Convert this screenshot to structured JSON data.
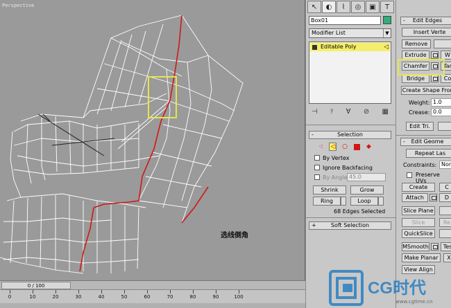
{
  "viewport": {
    "label": "Perspective",
    "caption": "选线倒角"
  },
  "timeline": {
    "frame_display": "0 / 100",
    "ticks": [
      "0",
      "10",
      "20",
      "30",
      "40",
      "50",
      "60",
      "70",
      "80",
      "90",
      "100"
    ]
  },
  "panel": {
    "tabs": [
      "create-icon",
      "modify-icon",
      "hierarchy-icon",
      "motion-icon",
      "display-icon",
      "utilities-icon"
    ],
    "object_name": "Box01",
    "object_color": "#2fae7d",
    "modifier_list": "Modifier List",
    "stack_item": "Editable Poly",
    "selection": {
      "title": "Selection",
      "by_vertex": "By Vertex",
      "ignore_backfacing": "Ignore Backfacing",
      "by_angle": "By Angle:",
      "angle_value": "45.0",
      "shrink": "Shrink",
      "grow": "Grow",
      "ring": "Ring",
      "loop": "Loop",
      "status": "68 Edges Selected"
    },
    "soft_selection": "Soft Selection"
  },
  "edit_edges": {
    "title": "Edit Edges",
    "insert_vertex": "Insert Verte",
    "remove": "Remove",
    "extrude": "Extrude",
    "chamfer": "Chamfer",
    "target_weld": "Tar",
    "bridge": "Bridge",
    "connect": "Co",
    "create_shape": "Create Shape From",
    "weight_label": "Weight:",
    "weight_value": "1.0",
    "crease_label": "Crease:",
    "crease_value": "0.0",
    "edit_tri": "Edit Tri.",
    "w": "W"
  },
  "edit_geometry": {
    "title": "Edit Geome",
    "repeat_last": "Repeat Las",
    "constraints_label": "Constraints:",
    "constraints_value": "Non",
    "preserve_uvs": "Preserve UVs",
    "create": "Create",
    "collapse": "C",
    "attach": "Attach",
    "detach": "D",
    "slice_plane": "Slice Plane",
    "slice": "Slice",
    "reset": "Re",
    "quickslice": "QuickSlice",
    "msmooth": "MSmooth",
    "tessellate": "Tes",
    "make_planar": "Make Planar",
    "x": "X",
    "view_align": "View Align"
  },
  "watermark": {
    "brand": "CG时代",
    "url": "www.cgtime.cn"
  }
}
